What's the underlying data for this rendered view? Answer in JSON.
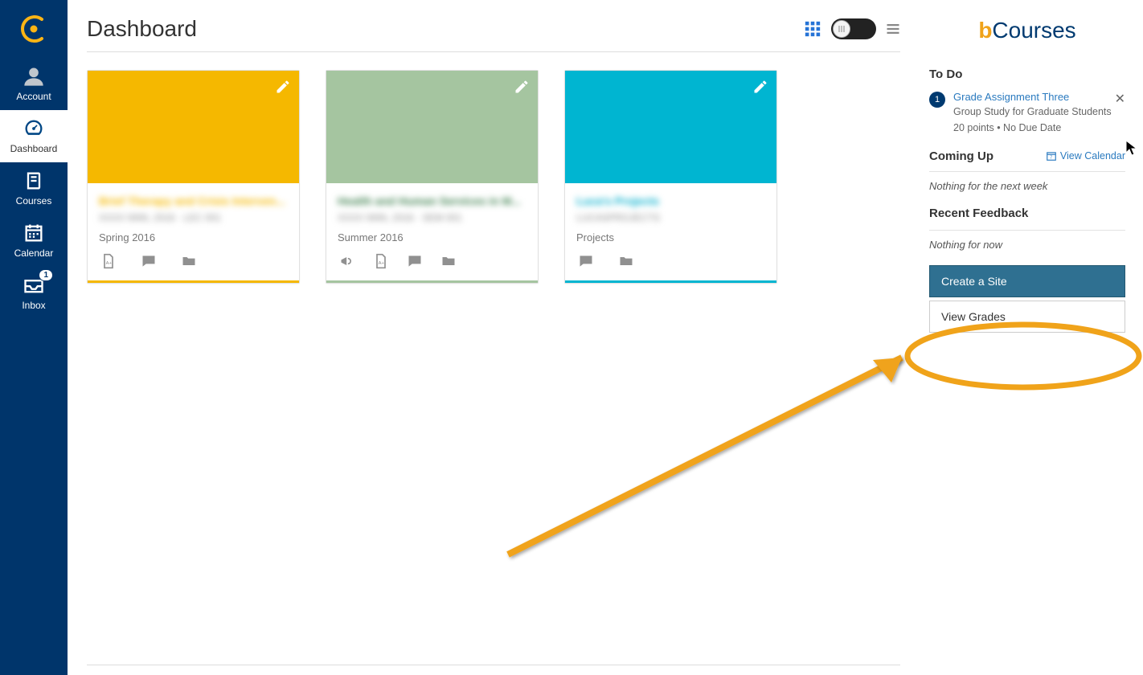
{
  "nav": {
    "account": "Account",
    "dashboard": "Dashboard",
    "courses": "Courses",
    "calendar": "Calendar",
    "inbox": "Inbox",
    "inbox_badge": "1"
  },
  "header": {
    "title": "Dashboard"
  },
  "cards": [
    {
      "color": "#f5b800",
      "title": "Brief Therapy and Crisis Interven...",
      "sub": "XXXX NNN, 2016 · LEC 001",
      "term": "Spring 2016",
      "icons": [
        "file",
        "chat",
        "folder"
      ]
    },
    {
      "color": "#a5c5a0",
      "title": "Health and Human Services in M...",
      "sub": "XXXX NNN, 2016 · SEM 001",
      "term": "Summer 2016",
      "icons": [
        "announce",
        "file",
        "chat",
        "folder"
      ]
    },
    {
      "color": "#00b5d1",
      "title": "Luca's Projects",
      "sub": "LUCASPROJECTS",
      "term": "Projects",
      "icons": [
        "chat",
        "folder"
      ]
    }
  ],
  "brand_prefix": "b",
  "brand_suffix": "Courses",
  "sidebar": {
    "todo_heading": "To Do",
    "todo": {
      "badge": "1",
      "link": "Grade Assignment Three",
      "course": "Group Study for Graduate Students",
      "meta": "20 points • No Due Date"
    },
    "coming_heading": "Coming Up",
    "view_calendar": "View Calendar",
    "coming_msg": "Nothing for the next week",
    "feedback_heading": "Recent Feedback",
    "feedback_msg": "Nothing for now",
    "create_site": "Create a Site",
    "view_grades": "View Grades"
  }
}
